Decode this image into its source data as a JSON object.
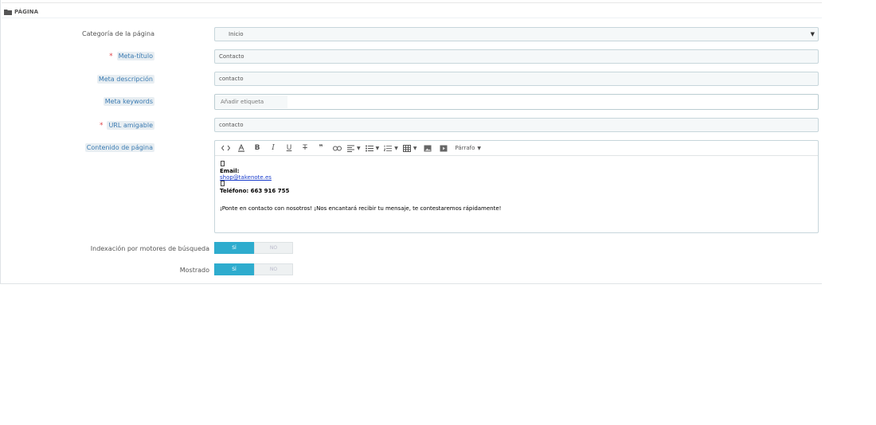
{
  "panel": {
    "title": "PÁGINA",
    "heading_icon": "folder-icon"
  },
  "form": {
    "category": {
      "label": "Categoría de la página",
      "value": "Inicio"
    },
    "meta_title": {
      "required": "*",
      "label": "Meta-título",
      "value": "Contacto"
    },
    "meta_description": {
      "label": "Meta descripción",
      "value": "contacto"
    },
    "meta_keywords": {
      "label": "Meta keywords",
      "placeholder": "Añadir etiqueta"
    },
    "friendly_url": {
      "required": "*",
      "label": "URL amigable",
      "value": "contacto"
    },
    "page_content": {
      "label": "Contenido de página",
      "toolbar": {
        "icons": [
          "code-icon",
          "text-color-icon",
          "bold-icon",
          "italic-icon",
          "underline-icon",
          "strikethrough-icon",
          "blockquote-icon",
          "link-icon",
          "align-icon",
          "bullet-list-icon",
          "numbered-list-icon",
          "table-icon",
          "image-icon",
          "media-icon"
        ],
        "paragraph_label": "Párrafo"
      },
      "content": {
        "email_label": "Email:",
        "email": "shop@takenote.es",
        "phone_label": "Teléfono: 663 916 755",
        "message": "¡Ponte en contacto con nosotros! ¡Nos encantará recibir tu mensaje, te contestaremos rápidamente!"
      }
    },
    "indexation": {
      "label": "Indexación por motores de búsqueda",
      "yes": "SÍ",
      "no": "NO",
      "selected": "SÍ"
    },
    "displayed": {
      "label": "Mostrado",
      "yes": "SÍ",
      "no": "NO",
      "selected": "SÍ"
    }
  },
  "colors": {
    "accent": "#2eacce",
    "required": "#e0474c",
    "hint_text": "#3b7bb2",
    "link": "#1a3dcc"
  }
}
